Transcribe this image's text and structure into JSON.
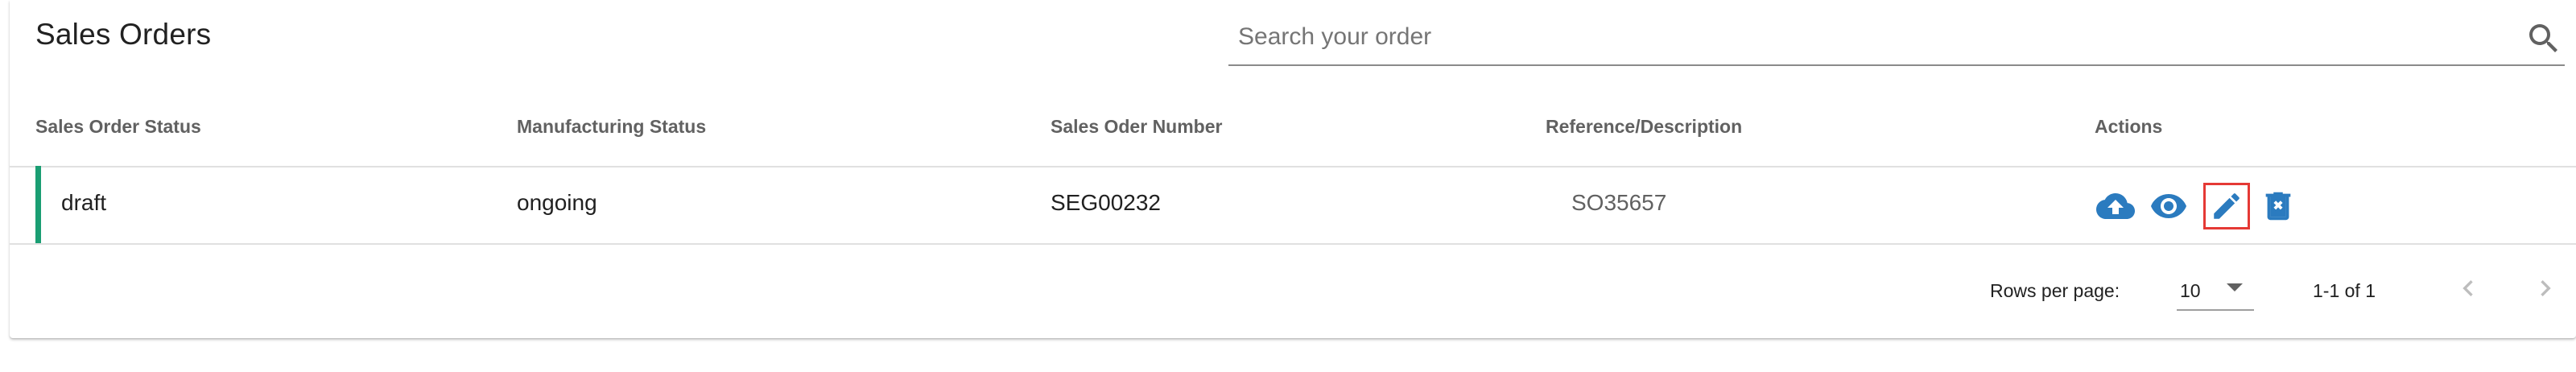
{
  "page": {
    "title": "Sales Orders"
  },
  "search": {
    "placeholder": "Search your order",
    "value": "",
    "icon": "search-icon"
  },
  "table": {
    "columns": [
      "Sales Order Status",
      "Manufacturing Status",
      "Sales Oder Number",
      "Reference/Description",
      "Actions"
    ],
    "rows": [
      {
        "sales_order_status": "draft",
        "manufacturing_status": "ongoing",
        "sales_order_number": "SEG00232",
        "reference_description": "SO35657",
        "status_color": "#1a9e73",
        "actions": [
          "upload-cloud-icon",
          "view-eye-icon",
          "edit-pencil-icon",
          "delete-bin-icon"
        ]
      }
    ]
  },
  "pagination": {
    "rows_per_page_label": "Rows per page:",
    "rows_per_page_value": "10",
    "range_label": "1-1 of 1",
    "prev_icon": "chevron-left-icon",
    "next_icon": "chevron-right-icon"
  },
  "colors": {
    "action_blue": "#2b7bbf",
    "highlight_red": "#e53935",
    "status_green": "#1a9e73"
  }
}
